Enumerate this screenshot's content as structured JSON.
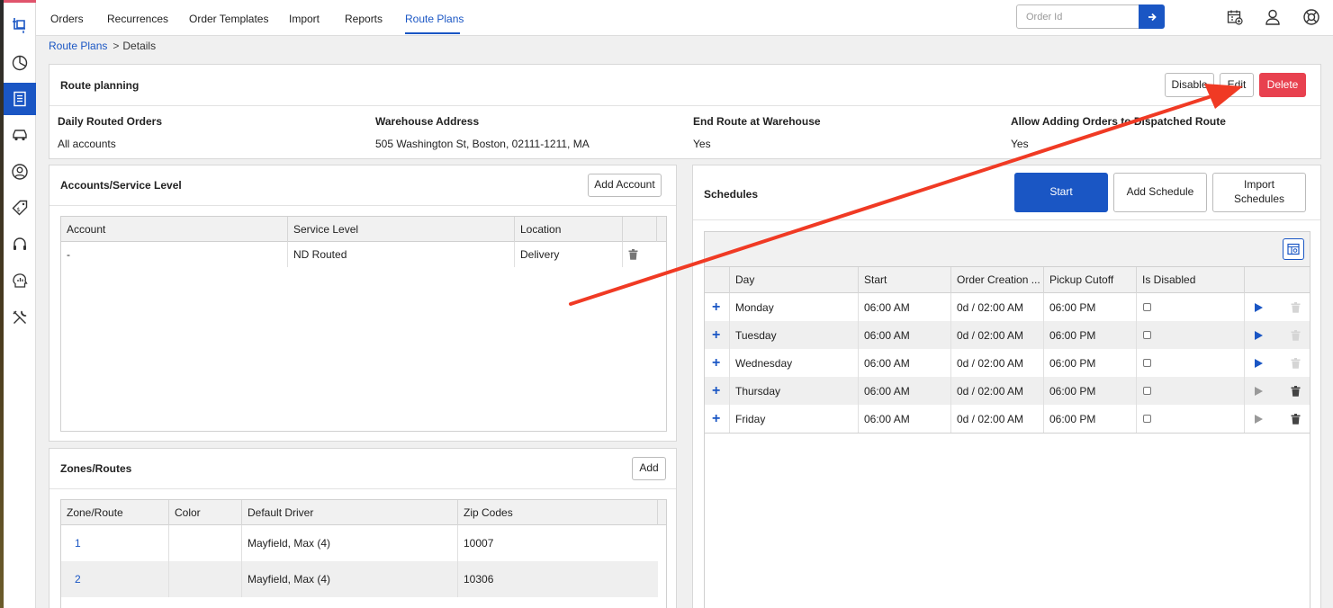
{
  "nav": {
    "tabs": [
      "Orders",
      "Recurrences",
      "Order Templates",
      "Import",
      "Reports",
      "Route Plans"
    ],
    "active_tab": "Route Plans",
    "order_search": {
      "placeholder": "Order Id",
      "value": ""
    },
    "sidebar_icons": [
      "logo-icon",
      "pie-chart-icon",
      "orders-list-icon",
      "car-icon",
      "user-circle-icon",
      "price-tag-icon",
      "headset-icon",
      "analytics-head-icon",
      "tools-icon"
    ],
    "top_icons": [
      "calendar-add-icon",
      "user-icon",
      "support-lifebuoy-icon"
    ]
  },
  "breadcrumb": {
    "parent": "Route Plans",
    "separator": ">",
    "current": "Details"
  },
  "route_planning": {
    "title": "Route planning",
    "disable_label": "Disable",
    "edit_label": "Edit",
    "delete_label": "Delete",
    "fields": [
      {
        "label": "Daily Routed Orders",
        "value": "All accounts"
      },
      {
        "label": "Warehouse Address",
        "value": "505 Washington St, Boston, 02111-1211, MA"
      },
      {
        "label": "End Route at Warehouse",
        "value": "Yes"
      },
      {
        "label": "Allow Adding Orders to Dispatched Route",
        "value": "Yes"
      }
    ]
  },
  "accounts": {
    "title": "Accounts/Service Level",
    "add_label": "Add Account",
    "columns": [
      "Account",
      "Service Level",
      "Location"
    ],
    "rows": [
      {
        "account": "-",
        "service_level": "ND Routed",
        "location": "Delivery"
      }
    ]
  },
  "zones": {
    "title": "Zones/Routes",
    "add_label": "Add",
    "columns": [
      "Zone/Route",
      "Color",
      "Default Driver",
      "Zip Codes"
    ],
    "rows": [
      {
        "zone": "1",
        "color": "",
        "driver": "Mayfield, Max (4)",
        "zips": "10007"
      },
      {
        "zone": "2",
        "color": "",
        "driver": "Mayfield, Max (4)",
        "zips": "10306"
      }
    ]
  },
  "schedules": {
    "title": "Schedules",
    "start_label": "Start",
    "add_label": "Add Schedule",
    "import_label": "Import Schedules",
    "columns": [
      "Day",
      "Start",
      "Order Creation ...",
      "Pickup Cutoff",
      "Is Disabled"
    ],
    "rows": [
      {
        "day": "Monday",
        "start": "06:00 AM",
        "creation": "0d / 02:00 AM",
        "cutoff": "06:00 PM",
        "disabled": false,
        "play_active": true,
        "delete_active": false
      },
      {
        "day": "Tuesday",
        "start": "06:00 AM",
        "creation": "0d / 02:00 AM",
        "cutoff": "06:00 PM",
        "disabled": false,
        "play_active": true,
        "delete_active": false
      },
      {
        "day": "Wednesday",
        "start": "06:00 AM",
        "creation": "0d / 02:00 AM",
        "cutoff": "06:00 PM",
        "disabled": false,
        "play_active": true,
        "delete_active": false
      },
      {
        "day": "Thursday",
        "start": "06:00 AM",
        "creation": "0d / 02:00 AM",
        "cutoff": "06:00 PM",
        "disabled": false,
        "play_active": false,
        "delete_active": true
      },
      {
        "day": "Friday",
        "start": "06:00 AM",
        "creation": "0d / 02:00 AM",
        "cutoff": "06:00 PM",
        "disabled": false,
        "play_active": false,
        "delete_active": true
      }
    ]
  },
  "colors": {
    "accent": "#1a56c4",
    "danger": "#e8414f",
    "annotation_arrow": "#f03a24"
  }
}
